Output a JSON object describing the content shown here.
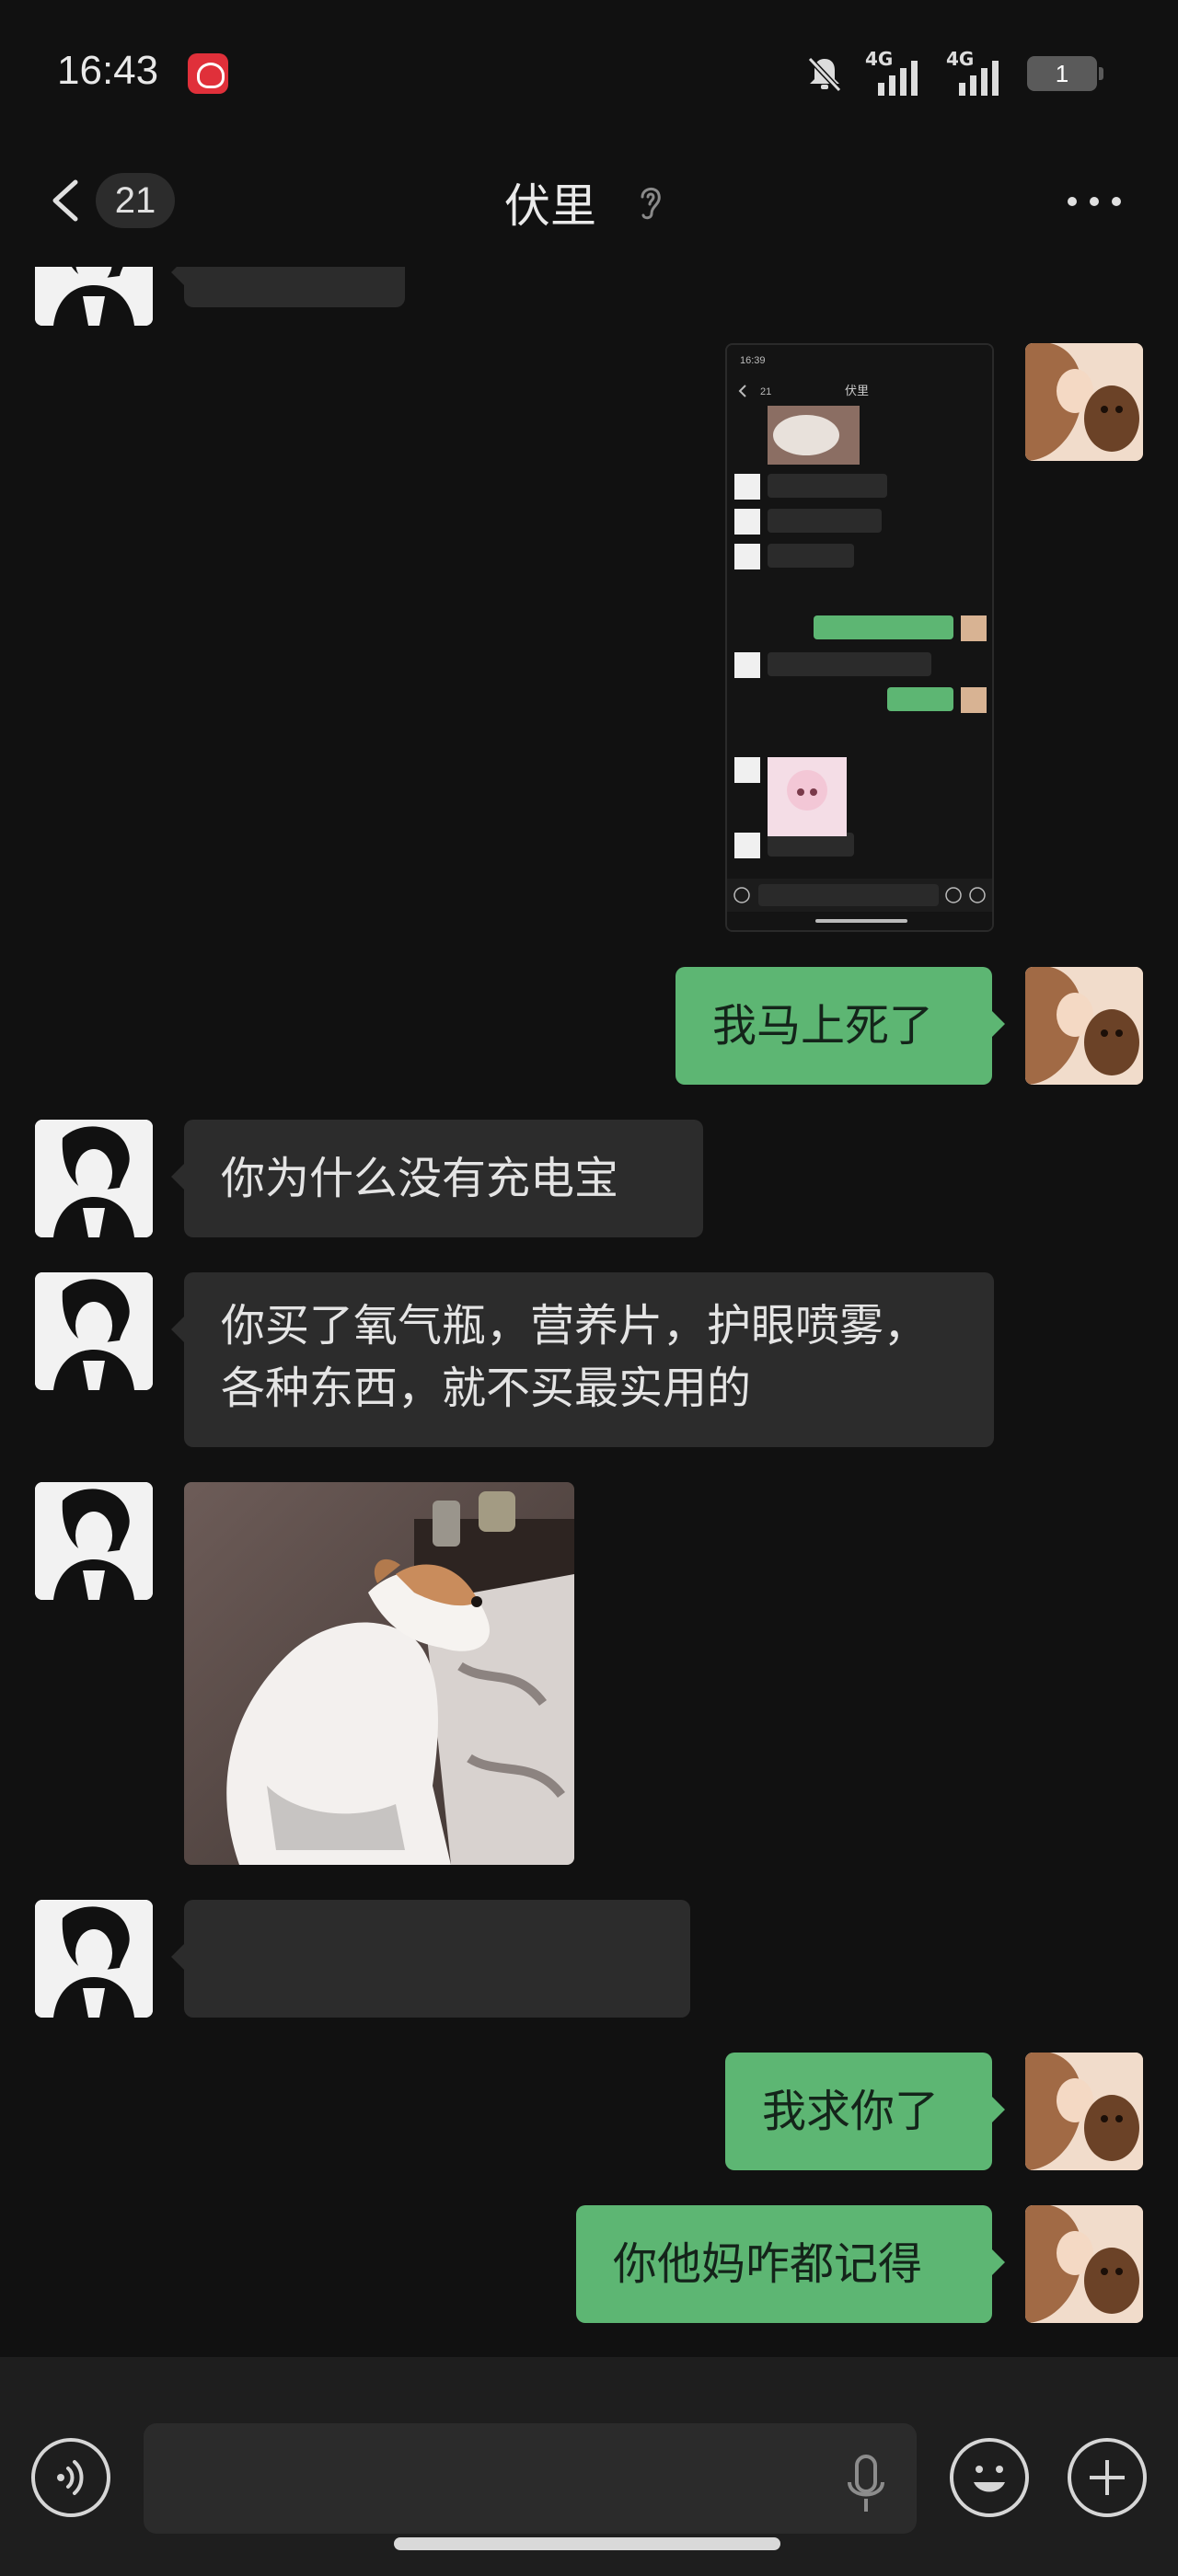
{
  "status_bar": {
    "time": "16:43",
    "network_1": "4G",
    "network_2": "4G",
    "battery": "1"
  },
  "nav": {
    "unread_count": "21",
    "title": "伏里"
  },
  "messages": [
    {
      "side": "in",
      "type": "text",
      "text": ""
    },
    {
      "side": "out",
      "type": "image",
      "image": "screenshot-of-chat"
    },
    {
      "side": "out",
      "type": "text",
      "text": "我马上死了"
    },
    {
      "side": "in",
      "type": "text",
      "text": "你为什么没有充电宝"
    },
    {
      "side": "in",
      "type": "text",
      "lines": [
        "你买了氧气瓶，营养片，护眼喷雾，",
        "各种东西，就不买最实用的"
      ]
    },
    {
      "side": "in",
      "type": "image",
      "image": "dog-sticker"
    },
    {
      "side": "in",
      "type": "text",
      "text": ""
    },
    {
      "side": "out",
      "type": "text",
      "text": "我求你了"
    },
    {
      "side": "out",
      "type": "text",
      "text": "你他妈咋都记得"
    }
  ],
  "embedded_screenshot": {
    "time": "16:39",
    "badge": "21",
    "title": "伏里"
  },
  "input": {
    "placeholder": ""
  },
  "colors": {
    "background": "#111111",
    "bubble_in": "#2c2c2c",
    "bubble_out": "#5db673",
    "input_bar": "#1e1e1e"
  },
  "icons": {
    "back": "chevron-left-icon",
    "ear": "ear-icon",
    "more": "more-dots-icon",
    "voice": "voice-icon",
    "mic": "mic-icon",
    "emoji": "emoji-icon",
    "plus": "plus-icon"
  }
}
